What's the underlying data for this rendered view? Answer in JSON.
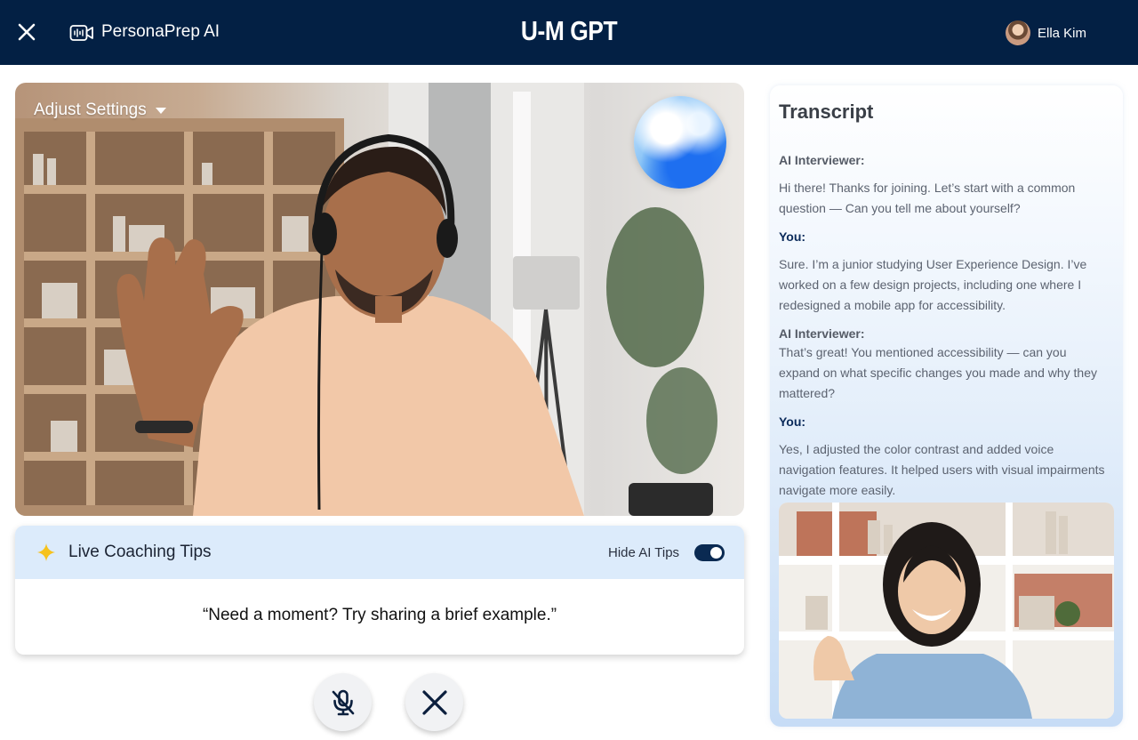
{
  "header": {
    "app_name": "PersonaPrep AI",
    "brand": "U-M GPT",
    "user_name": "Ella Kim",
    "close_icon": "close-icon",
    "app_icon": "video-camera-icon"
  },
  "video": {
    "adjust_settings_label": "Adjust Settings",
    "ai_avatar": "ai-orb-avatar"
  },
  "coaching": {
    "title": "Live Coaching Tips",
    "hide_label": "Hide AI Tips",
    "toggle_on": true,
    "tip": "“Need a moment? Try sharing a brief example.”"
  },
  "controls": {
    "mute_icon": "microphone-off-icon",
    "end_icon": "close-icon"
  },
  "transcript": {
    "title": "Transcript",
    "messages": [
      {
        "speaker": "AI Interviewer:",
        "text": "Hi there! Thanks for joining. Let’s start with a common question — Can you tell me about yourself?"
      },
      {
        "speaker": "You:",
        "text": "Sure. I’m a junior studying User Experience Design. I’ve worked on a few design projects, including one where I redesigned a mobile app for accessibility."
      },
      {
        "speaker": "AI Interviewer:",
        "text": "That’s great! You mentioned accessibility — can you expand on what specific changes you made and why they mattered?"
      },
      {
        "speaker": "You:",
        "text": "Yes, I adjusted the color contrast and added voice navigation features. It helped users with visual impairments navigate more easily."
      }
    ]
  },
  "colors": {
    "header_bg": "#032044",
    "coach_header_bg": "#dcebfb",
    "toggle_on": "#0a2a52",
    "speaker_you": "#0a2a5a"
  }
}
